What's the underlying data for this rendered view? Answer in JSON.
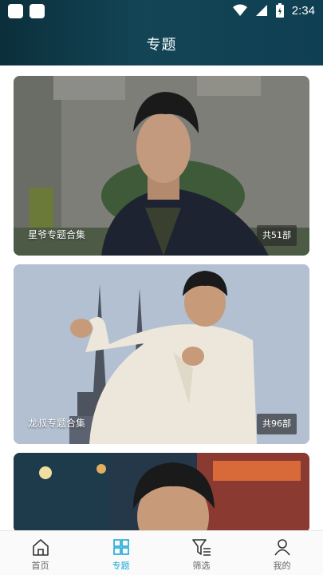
{
  "status_bar": {
    "time": "2:34"
  },
  "header": {
    "title": "专题"
  },
  "cards": [
    {
      "caption": "星爷专题合集",
      "count": "共51部"
    },
    {
      "caption": "龙叔专题合集",
      "count": "共96部"
    },
    {
      "caption": "",
      "count": ""
    }
  ],
  "tab_bar": {
    "active": "专题",
    "items": [
      {
        "label": "首页",
        "icon": "home-icon"
      },
      {
        "label": "专题",
        "icon": "grid-icon"
      },
      {
        "label": "筛选",
        "icon": "filter-icon"
      },
      {
        "label": "我的",
        "icon": "user-icon"
      }
    ]
  },
  "colors": {
    "header_bg": "#134556",
    "accent": "#1aa8d8",
    "tab_inactive": "#666666"
  }
}
